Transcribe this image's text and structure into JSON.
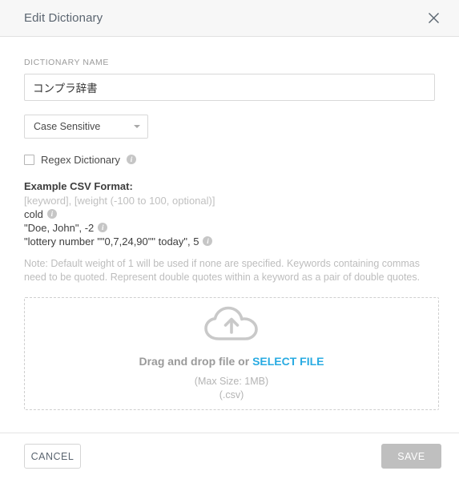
{
  "dialog": {
    "title": "Edit Dictionary",
    "close_icon": "close-icon"
  },
  "form": {
    "name_label": "DICTIONARY NAME",
    "name_value": "コンプラ辞書",
    "name_placeholder": "",
    "case_select": {
      "value": "Case Sensitive",
      "caret_icon": "chevron-down-icon"
    },
    "regex_checkbox": {
      "label": "Regex Dictionary",
      "checked": false,
      "info_icon": "info-icon",
      "info_glyph": "i"
    }
  },
  "csv": {
    "title": "Example CSV Format:",
    "pattern": "[keyword], [weight (-100 to 100, optional)]",
    "examples": [
      {
        "text": "cold",
        "info_glyph": "i"
      },
      {
        "text": "\"Doe, John\", -2",
        "info_glyph": "i"
      },
      {
        "text": "\"lottery number \"\"0,7,24,90\"\" today\", 5",
        "info_glyph": "i"
      }
    ],
    "note": "Note: Default weight of 1 will be used if none are specified. Keywords containing commas need to be quoted. Represent double quotes within a keyword as a pair of double quotes."
  },
  "dropzone": {
    "icon": "cloud-upload-icon",
    "prompt_prefix": "Drag and drop file or",
    "select_file_label": "SELECT FILE",
    "max_size": "(Max Size: 1MB)",
    "file_type": "(.csv)"
  },
  "footer": {
    "cancel_label": "CANCEL",
    "save_label": "SAVE",
    "save_disabled": true
  },
  "colors": {
    "accent_link": "#29abe2",
    "header_bg": "#f7f7f7",
    "save_disabled_bg": "#bfbfbf",
    "muted_text": "#bdbdbd"
  }
}
